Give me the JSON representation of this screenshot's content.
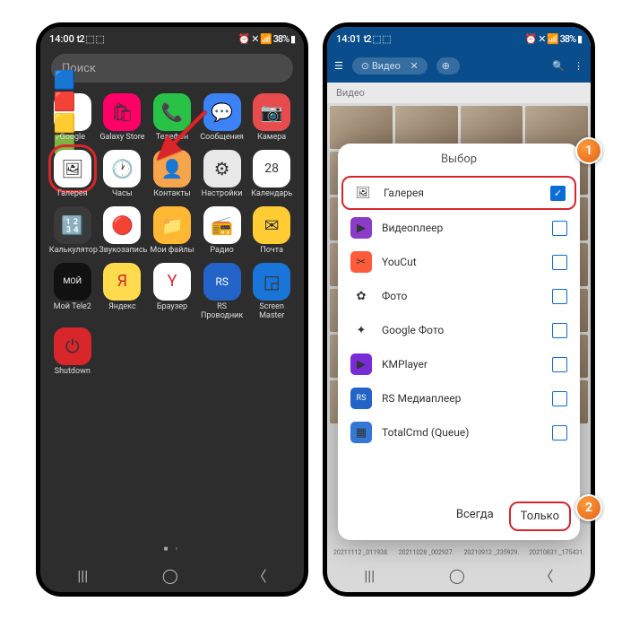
{
  "left": {
    "time": "14:00",
    "statusIcons": "t2 ⬚ ⬚",
    "statusRight": "⏰ ✕ 📶 38% ▮",
    "search": "Поиск",
    "rows": [
      [
        {
          "n": "google-icon",
          "bg": "#fff",
          "g": "🟦🟥🟨🟩",
          "l": "Google"
        },
        {
          "n": "galaxy-store-icon",
          "bg": "#f06",
          "g": "🛍",
          "l": "Galaxy Store"
        },
        {
          "n": "phone-icon",
          "bg": "#28c346",
          "g": "📞",
          "l": "Телефон"
        },
        {
          "n": "messages-icon",
          "bg": "#3b82f6",
          "g": "💬",
          "l": "Сообщения"
        },
        {
          "n": "camera-icon",
          "bg": "#e84b4b",
          "g": "📷",
          "l": "Камера"
        }
      ],
      [
        {
          "n": "gallery-icon",
          "bg": "#fff",
          "g": "🖼",
          "l": "Галерея",
          "hl": true
        },
        {
          "n": "clock-icon",
          "bg": "#fff",
          "g": "🕐",
          "l": "Часы"
        },
        {
          "n": "contacts-icon",
          "bg": "#f6a54c",
          "g": "👤",
          "l": "Контакты"
        },
        {
          "n": "settings-icon",
          "bg": "#e8e8e8",
          "g": "⚙",
          "l": "Настройки"
        },
        {
          "n": "calendar-icon",
          "bg": "#fff",
          "g": "28",
          "l": "Календарь",
          "fs": "14px",
          "fc": "#333"
        }
      ],
      [
        {
          "n": "calculator-icon",
          "bg": "#3a3a3a",
          "g": "🔢",
          "l": "Калькулятор"
        },
        {
          "n": "recorder-icon",
          "bg": "#fff",
          "g": "🔴",
          "l": "Звукозапись"
        },
        {
          "n": "files-icon",
          "bg": "#ffb833",
          "g": "📁",
          "l": "Мои файлы"
        },
        {
          "n": "radio-icon",
          "bg": "#fff",
          "g": "📻",
          "l": "Радио"
        },
        {
          "n": "mail-icon",
          "bg": "#fc3",
          "g": "✉",
          "l": "Почта"
        }
      ],
      [
        {
          "n": "tele2-icon",
          "bg": "#111",
          "g": "МОЙ",
          "l": "Мой Tele2",
          "fs": "9px",
          "fc": "#fff"
        },
        {
          "n": "yandex-icon",
          "bg": "#ffdb4d",
          "g": "Я",
          "l": "Яндекс",
          "fc": "#d8262b",
          "fs": "18px"
        },
        {
          "n": "browser-icon",
          "bg": "#fff",
          "g": "Y",
          "l": "Браузер",
          "fc": "#d8262b",
          "fs": "18px"
        },
        {
          "n": "rs-icon",
          "bg": "#2463c7",
          "g": "RS",
          "l": "RS Проводник",
          "fs": "12px",
          "fc": "#fff"
        },
        {
          "n": "screenmaster-icon",
          "bg": "#1a75d8",
          "g": "◲",
          "l": "Screen Master"
        }
      ],
      [
        {
          "n": "shutdown-icon",
          "bg": "#d8262b",
          "g": "⏻",
          "l": "Shutdown"
        },
        {},
        {},
        {},
        {}
      ]
    ],
    "dots": "■ ▫"
  },
  "right": {
    "time": "14:01",
    "statusIcons": "t2 ⬚ ⬚",
    "statusRight": "⏰ ✕ 📶 38% ▮",
    "tbChip": "⊙ Видео",
    "tbX": "✕",
    "tab": "Видео",
    "dialogTitle": "Выбор",
    "items": [
      {
        "n": "app-gallery",
        "g": "🖼",
        "bg": "#fff",
        "l": "Галерея",
        "on": true,
        "sel": true
      },
      {
        "n": "app-videoplayer",
        "g": "▶",
        "bg": "#8a3cc9",
        "l": "Видеоплеер"
      },
      {
        "n": "app-youcut",
        "g": "✂",
        "bg": "#ff5b3a",
        "l": "YouCut"
      },
      {
        "n": "app-photo",
        "g": "✿",
        "bg": "#fff",
        "l": "Фото"
      },
      {
        "n": "app-gphotos",
        "g": "✦",
        "bg": "#fff",
        "l": "Google Фото"
      },
      {
        "n": "app-kmplayer",
        "g": "▶",
        "bg": "#7a2bd8",
        "l": "KMPlayer"
      },
      {
        "n": "app-rsmedia",
        "g": "RS",
        "bg": "#2463c7",
        "l": "RS Медиаплеер",
        "fs": "9px",
        "fc": "#fff"
      },
      {
        "n": "app-totalcmd",
        "g": "▦",
        "bg": "#3478d6",
        "l": "TotalCmd (Queue)"
      }
    ],
    "btnAlways": "Всегда",
    "btnOnce": "Только",
    "caps": [
      "20211112 _011938.",
      "20211028 _002927.",
      "20210912 _235929.",
      "20210831 _175431."
    ],
    "badge1": "1",
    "badge2": "2"
  }
}
